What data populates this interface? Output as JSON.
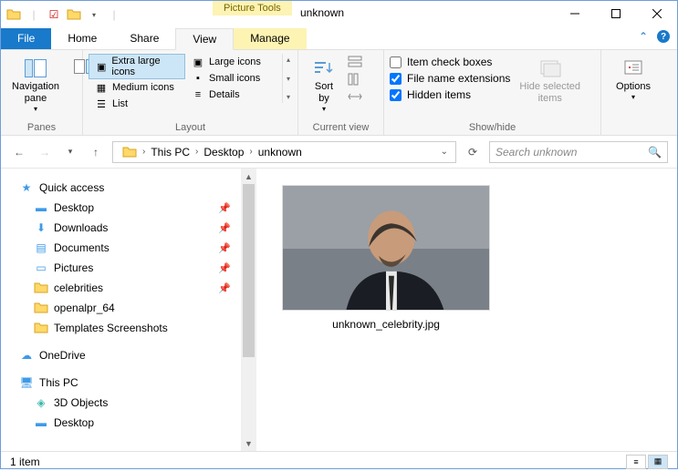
{
  "title_tools": "Picture Tools",
  "window_title": "unknown",
  "tabs": {
    "file": "File",
    "home": "Home",
    "share": "Share",
    "view": "View",
    "manage": "Manage"
  },
  "ribbon": {
    "panes": {
      "nav": "Navigation\npane",
      "label": "Panes"
    },
    "layout": {
      "xl": "Extra large icons",
      "large": "Large icons",
      "medium": "Medium icons",
      "small": "Small icons",
      "list": "List",
      "details": "Details",
      "label": "Layout"
    },
    "current": {
      "sort": "Sort\nby",
      "label": "Current view"
    },
    "showhide": {
      "check1": "Item check boxes",
      "check2": "File name extensions",
      "check3": "Hidden items",
      "hide": "Hide selected\nitems",
      "label": "Show/hide"
    },
    "options": "Options"
  },
  "breadcrumb": {
    "b1": "This PC",
    "b2": "Desktop",
    "b3": "unknown"
  },
  "search_placeholder": "Search unknown",
  "sidebar": {
    "quick": "Quick access",
    "desktop": "Desktop",
    "downloads": "Downloads",
    "documents": "Documents",
    "pictures": "Pictures",
    "celebrities": "celebrities",
    "openalpr": "openalpr_64",
    "templates": "Templates Screenshots",
    "onedrive": "OneDrive",
    "thispc": "This PC",
    "objects3d": "3D Objects",
    "desktop2": "Desktop"
  },
  "file": {
    "name": "unknown_celebrity.jpg"
  },
  "status": "1 item"
}
